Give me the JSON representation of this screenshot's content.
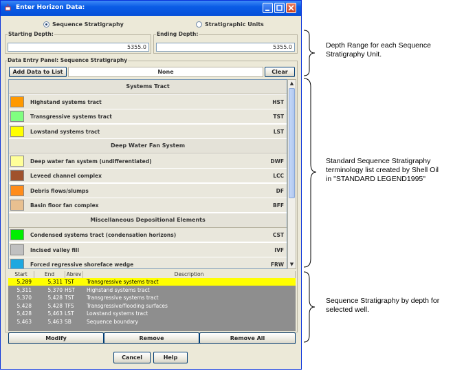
{
  "window": {
    "title": "Enter Horizon Data:"
  },
  "mode": {
    "options": [
      {
        "label": "Sequence Stratigraphy",
        "selected": true
      },
      {
        "label": "Stratigraphic Units",
        "selected": false
      }
    ]
  },
  "depth": {
    "start_label": "Starting Depth:",
    "start_value": "5355.0",
    "end_label": "Ending Depth:",
    "end_value": "5355.0"
  },
  "panel": {
    "title": "Data Entry Panel: Sequence Stratigraphy",
    "add_label": "Add Data to List",
    "selection": "None",
    "clear_label": "Clear"
  },
  "legend": {
    "sections": [
      {
        "title": "Systems Tract",
        "items": [
          {
            "name": "Highstand systems tract",
            "abbr": "HST",
            "color": "#ff9900"
          },
          {
            "name": "Transgressive systems tract",
            "abbr": "TST",
            "color": "#80ff80"
          },
          {
            "name": "Lowstand systems tract",
            "abbr": "LST",
            "color": "#ffff00"
          }
        ]
      },
      {
        "title": "Deep Water Fan System",
        "items": [
          {
            "name": "Deep water fan system (undifferentiated)",
            "abbr": "DWF",
            "color": "#ffff99"
          },
          {
            "name": "Leveed channel complex",
            "abbr": "LCC",
            "color": "#a0522d"
          },
          {
            "name": "Debris flows/slumps",
            "abbr": "DF",
            "color": "#ff8c1a"
          },
          {
            "name": "Basin floor fan complex",
            "abbr": "BFF",
            "color": "#e8c090"
          }
        ]
      },
      {
        "title": "Miscellaneous Depositional Elements",
        "items": [
          {
            "name": "Condensed systems tract (condensation horizons)",
            "abbr": "CST",
            "color": "#00ee00"
          },
          {
            "name": "Incised valley fill",
            "abbr": "IVF",
            "color": "#c0c0c0"
          },
          {
            "name": "Forced regressive shoreface wedge",
            "abbr": "FRW",
            "color": "#1ea8e0"
          }
        ]
      }
    ]
  },
  "table": {
    "columns": [
      "Start",
      "End",
      "Abrev",
      "Description"
    ],
    "rows": [
      {
        "start": "5,289",
        "end": "5,311",
        "abbr": "TST",
        "desc": "Transgressive systems tract",
        "selected": true
      },
      {
        "start": "5,311",
        "end": "5,370",
        "abbr": "HST",
        "desc": "Highstand systems tract",
        "selected": false
      },
      {
        "start": "5,370",
        "end": "5,428",
        "abbr": "TST",
        "desc": "Transgressive systems tract",
        "selected": false
      },
      {
        "start": "5,428",
        "end": "5,428",
        "abbr": "TFS",
        "desc": "Transgressive/flooding surfaces",
        "selected": false
      },
      {
        "start": "5,428",
        "end": "5,463",
        "abbr": "LST",
        "desc": "Lowstand systems tract",
        "selected": false
      },
      {
        "start": "5,463",
        "end": "5,463",
        "abbr": "SB",
        "desc": "Sequence boundary",
        "selected": false
      }
    ]
  },
  "actions": {
    "modify": "Modify",
    "remove": "Remove",
    "remove_all": "Remove All",
    "cancel": "Cancel",
    "help": "Help"
  },
  "annotations": {
    "depth_range": [
      "Depth Range for each Sequence",
      "Stratigraphy Unit."
    ],
    "legend_list": [
      "Standard Sequence Stratigraphy",
      "terminology list created by Shell Oil",
      "in \"STANDARD LEGEND1995\""
    ],
    "by_depth": [
      "Sequence Stratigraphy by depth for",
      "selected well."
    ]
  }
}
